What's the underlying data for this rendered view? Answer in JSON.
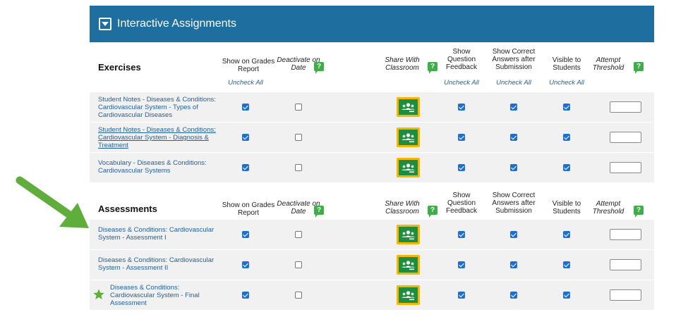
{
  "banner": {
    "title": "Interactive Assignments"
  },
  "columns": {
    "show_grades": "Show on Grades Report",
    "deactivate": "Deactivate on Date",
    "share": "Share With Classroom",
    "show_feedback": "Show Question Feedback",
    "show_correct": "Show Correct Answers after Submission",
    "visible": "Visible to Students",
    "attempt": "Attempt Threshold",
    "help_glyph": "?",
    "uncheck_all": "Uncheck All"
  },
  "exercises": {
    "title": "Exercises",
    "rows": [
      {
        "name": "Student Notes - Diseases & Conditions: Cardiovascular System - Types of Cardiovascular Diseases",
        "grades": true,
        "deactivate": false,
        "feedback": true,
        "correct": true,
        "visible": true,
        "threshold": ""
      },
      {
        "name": "Student Notes - Diseases & Conditions: Cardiovascular System - Diagnosis & Treatment",
        "grades": true,
        "deactivate": false,
        "feedback": true,
        "correct": true,
        "visible": true,
        "threshold": ""
      },
      {
        "name": "Vocabulary - Diseases & Conditions: Cardiovascular Systems",
        "grades": true,
        "deactivate": false,
        "feedback": true,
        "correct": true,
        "visible": true,
        "threshold": ""
      }
    ]
  },
  "assessments": {
    "title": "Assessments",
    "rows": [
      {
        "name": "Diseases & Conditions: Cardiovascular System - Assessment I",
        "grades": true,
        "deactivate": false,
        "feedback": true,
        "correct": true,
        "visible": true,
        "threshold": ""
      },
      {
        "name": "Diseases & Conditions: Cardiovascular System - Assessment II",
        "grades": true,
        "deactivate": false,
        "feedback": true,
        "correct": true,
        "visible": true,
        "threshold": ""
      },
      {
        "name": "Diseases & Conditions: Cardiovascular System - Final Assessment",
        "grades": true,
        "deactivate": false,
        "feedback": true,
        "correct": true,
        "visible": true,
        "threshold": "",
        "starred": true
      }
    ]
  },
  "icons": {
    "toggle": "collapse-toggle-icon",
    "share": "google-classroom-icon",
    "help": "help-speech-bubble-icon",
    "star": "star-icon",
    "arrow": "pointer-arrow-icon"
  },
  "colors": {
    "banner": "#1f6ea0",
    "link": "#1f5f9a",
    "checkbox": "#1f6fd0",
    "help": "#3fae49",
    "classroom_frame": "#f6b700",
    "classroom_board": "#1e8e3e",
    "arrow": "#5fae3c",
    "row_bg": "#f1f1f1"
  }
}
